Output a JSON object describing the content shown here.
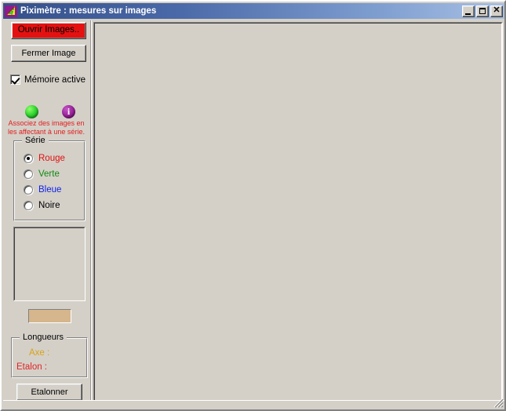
{
  "window": {
    "title": "Piximètre : mesures sur images",
    "icon_name": "piximetre-app-icon",
    "minimize_label": "_",
    "maximize_label": "□",
    "close_label": "✕"
  },
  "sidebar": {
    "open_images_button": "Ouvrir Images..",
    "close_image_button": "Fermer Image",
    "memory_checkbox_label": "Mémoire active",
    "memory_checkbox_checked": true,
    "hint_icons": {
      "green_icon_name": "green-sphere-icon",
      "info_icon_name": "info-icon",
      "info_glyph": "i"
    },
    "hint_line1": "Associez des images en",
    "hint_line2": "les affectant à une série.",
    "serie_group": {
      "title": "Série",
      "options": [
        {
          "label": "Rouge",
          "color": "#e01010",
          "selected": true
        },
        {
          "label": "Verte",
          "color": "#108a10",
          "selected": false
        },
        {
          "label": "Bleue",
          "color": "#1020e8",
          "selected": false
        },
        {
          "label": "Noire",
          "color": "#000000",
          "selected": false
        }
      ]
    },
    "thumbnail_panel_empty": true,
    "color_swatch": "#d6b68c",
    "longueurs_group": {
      "title": "Longueurs",
      "axe_label": "Axe :",
      "axe_value": "",
      "etalon_label": "Etalon :",
      "etalon_value": ""
    },
    "etalonner_button": "Etalonner"
  },
  "main": {
    "image_area_empty": true
  },
  "colors": {
    "face": "#d4d0c8",
    "title_left": "#35508a",
    "title_right": "#a8c0e4",
    "open_button_bg": "#e51111",
    "hint_text": "#e02020",
    "axe_text": "#d8a319",
    "etalon_text": "#e02424"
  }
}
